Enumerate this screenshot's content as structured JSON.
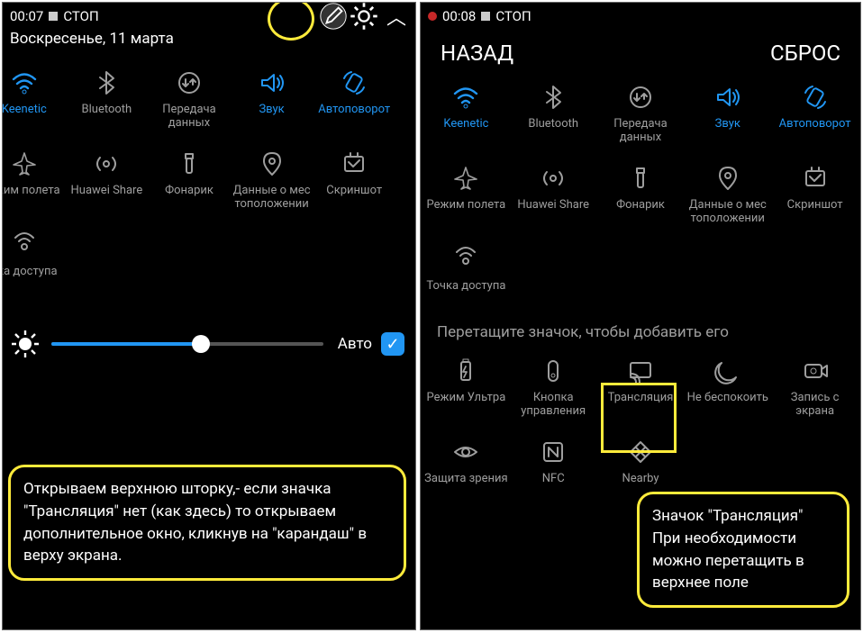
{
  "colors": {
    "accent": "#2196f3",
    "highlight": "#ffeb3b"
  },
  "left": {
    "status": {
      "time": "00:07",
      "stop_label": "СТОП"
    },
    "date": "Воскресенье, 11 марта",
    "tiles": {
      "row1": [
        {
          "label": "Keenetic",
          "icon": "wifi",
          "active": true
        },
        {
          "label": "Bluetooth",
          "icon": "bt",
          "active": false
        },
        {
          "label": "Передача данных",
          "icon": "data",
          "active": false
        },
        {
          "label": "Звук",
          "icon": "sound",
          "active": true
        },
        {
          "label": "Автоповорот",
          "icon": "rotate",
          "active": true
        }
      ],
      "row2": [
        {
          "label": "ежим полета",
          "icon": "airplane",
          "active": false
        },
        {
          "label": "Huawei Share",
          "icon": "hotspot",
          "active": false
        },
        {
          "label": "Фонарик",
          "icon": "torch",
          "active": false
        },
        {
          "label": "Данные о мес тоположении",
          "icon": "location",
          "active": false
        },
        {
          "label": "Скриншот",
          "icon": "screenshot",
          "active": false
        }
      ],
      "row3": [
        {
          "label": "чка доступа",
          "icon": "ap",
          "active": false
        }
      ]
    },
    "brightness": {
      "percent": 55,
      "auto_label": "Авто",
      "auto_checked": true
    },
    "callout": "Открываем верхнюю шторку,- если значка \"Трансляция\" нет (как здесь) то открываем дополнительное окно, кликнув на \"карандаш\" в верху экрана."
  },
  "right": {
    "status": {
      "time": "00:08",
      "stop_label": "СТОП"
    },
    "nav": {
      "back": "НАЗАД",
      "reset": "СБРОС"
    },
    "tiles": {
      "row1": [
        {
          "label": "Keenetic",
          "icon": "wifi",
          "active": true
        },
        {
          "label": "Bluetooth",
          "icon": "bt",
          "active": false
        },
        {
          "label": "Передача данных",
          "icon": "data",
          "active": false
        },
        {
          "label": "Звук",
          "icon": "sound",
          "active": true
        },
        {
          "label": "Автоповорот",
          "icon": "rotate",
          "active": true
        }
      ],
      "row2": [
        {
          "label": "Режим полета",
          "icon": "airplane",
          "active": false
        },
        {
          "label": "Huawei Share",
          "icon": "hotspot",
          "active": false
        },
        {
          "label": "Фонарик",
          "icon": "torch",
          "active": false
        },
        {
          "label": "Данные о мес тоположении",
          "icon": "location",
          "active": false
        },
        {
          "label": "Скриншот",
          "icon": "screenshot",
          "active": false
        }
      ],
      "row3": [
        {
          "label": "Точка доступа",
          "icon": "ap",
          "active": false
        }
      ]
    },
    "drag_hint": "Перетащите значок, чтобы добавить его",
    "extra": {
      "row1": [
        {
          "label": "Режим Ультра",
          "icon": "battery"
        },
        {
          "label": "Кнопка управления",
          "icon": "navkey"
        },
        {
          "label": "Трансляция",
          "icon": "cast"
        },
        {
          "label": "Не беспокоить",
          "icon": "dnd"
        },
        {
          "label": "Запись с экрана",
          "icon": "record"
        }
      ],
      "row2": [
        {
          "label": "Защита зрения",
          "icon": "eye"
        },
        {
          "label": "NFC",
          "icon": "nfc"
        }
      ],
      "row3": [
        {
          "label": "Nearby",
          "icon": "nearby"
        }
      ]
    },
    "callout": "Значок \"Трансляция\" При необходимости можно перетащить в верхнее поле"
  }
}
